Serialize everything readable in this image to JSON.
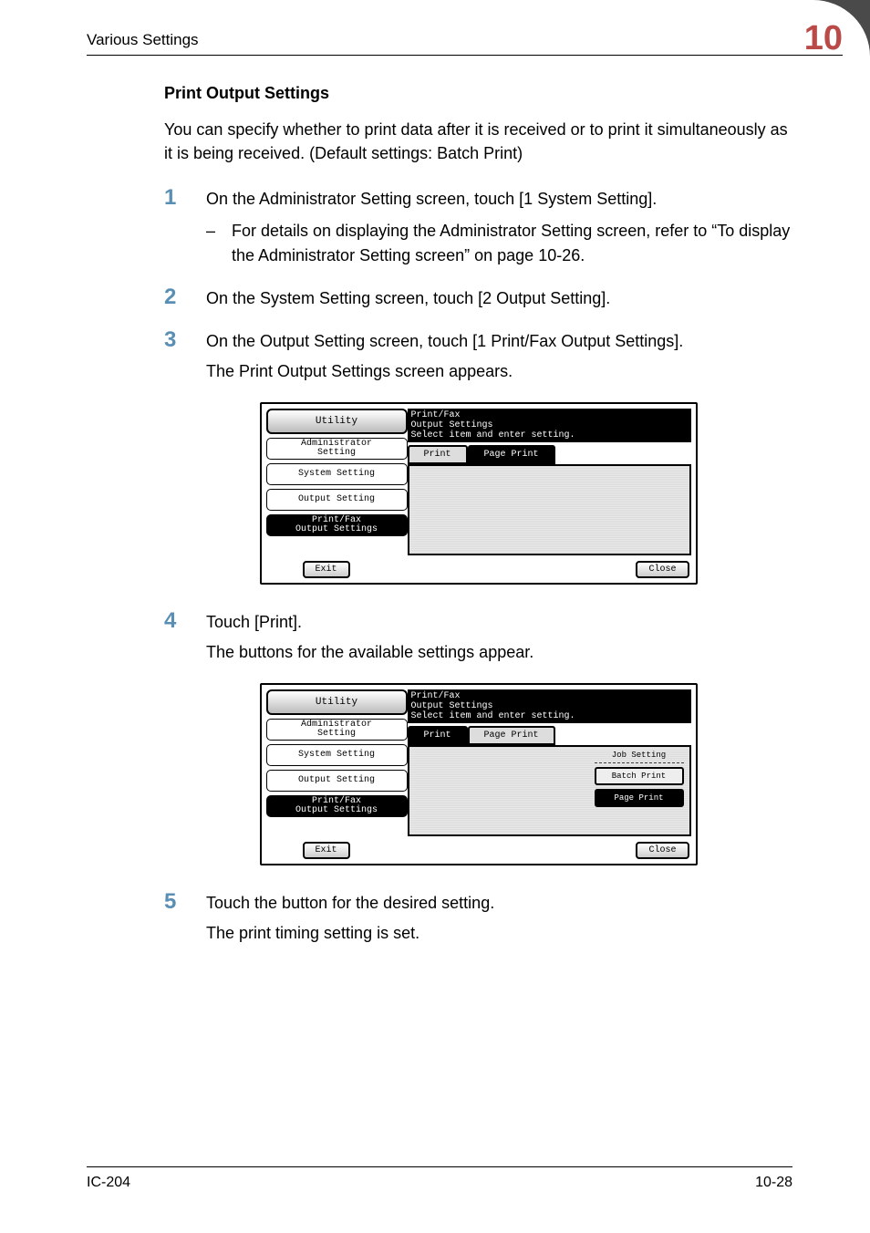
{
  "header": {
    "section_title": "Various Settings",
    "chapter_number": "10"
  },
  "section_heading": "Print Output Settings",
  "intro_paragraph": "You can specify whether to print data after it is received or to print it simultaneously as it is being received. (Default settings: Batch Print)",
  "steps": [
    {
      "num": "1",
      "text": "On the Administrator Setting screen, touch [1 System Setting].",
      "sub": [
        "For details on displaying the Administrator Setting screen, refer to “To display the Administrator Setting screen” on page 10-26."
      ]
    },
    {
      "num": "2",
      "text": "On the System Setting screen, touch [2 Output Setting]."
    },
    {
      "num": "3",
      "text": "On the Output Setting screen, touch [1 Print/Fax Output Settings].",
      "after": "The Print Output Settings screen appears."
    },
    {
      "num": "4",
      "text": "Touch [Print].",
      "after": "The buttons for the available settings appear."
    },
    {
      "num": "5",
      "text": "Touch the button for the desired setting.",
      "after": "The print timing setting is set."
    }
  ],
  "screenshot_common": {
    "utility_label": "Utility",
    "title_line1": "Print/Fax",
    "title_line2": "Output Settings",
    "instruction": "Select item and enter setting.",
    "crumbs": {
      "admin": "Administrator\nSetting",
      "system": "System Setting",
      "output": "Output Setting",
      "printfax": "Print/Fax\nOutput Settings"
    },
    "tab_print": "Print",
    "tab_page_print": "Page Print",
    "exit": "Exit",
    "close": "Close"
  },
  "screenshot2": {
    "job_setting": "Job Setting",
    "option_batch": "Batch Print",
    "option_page": "Page Print"
  },
  "footer": {
    "left": "IC-204",
    "right": "10-28"
  }
}
